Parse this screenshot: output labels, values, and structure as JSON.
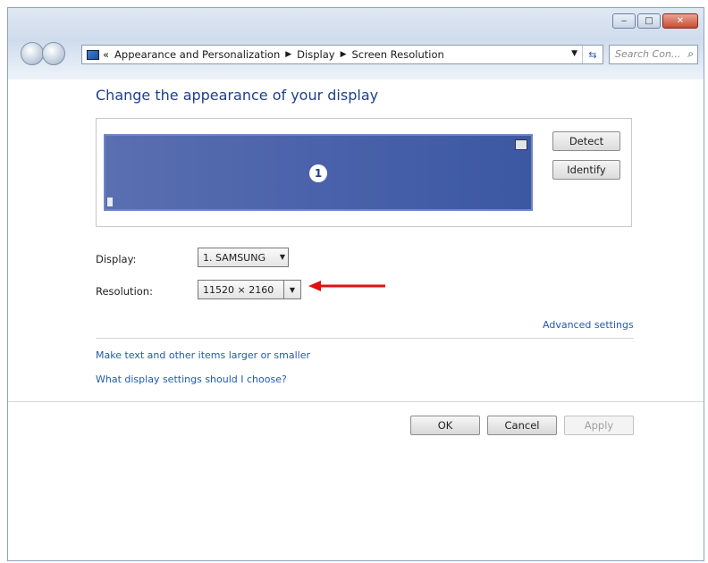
{
  "window": {
    "caption_buttons": [
      "minimize-icon",
      "maximize-icon",
      "close-icon"
    ]
  },
  "navbar": {
    "breadcrumb_prefix": "«",
    "breadcrumbs": [
      "Appearance and Personalization",
      "Display",
      "Screen Resolution"
    ],
    "search_placeholder": "Search Con..."
  },
  "main": {
    "title": "Change the appearance of your display",
    "monitor_number": "1",
    "detect_label": "Detect",
    "identify_label": "Identify",
    "display_label": "Display:",
    "display_value": "1. SAMSUNG",
    "resolution_label": "Resolution:",
    "resolution_value": "11520 × 2160",
    "advanced_settings_link": "Advanced settings",
    "link_text_size": "Make text and other items larger or smaller",
    "link_help": "What display settings should I choose?"
  },
  "footer": {
    "ok_label": "OK",
    "cancel_label": "Cancel",
    "apply_label": "Apply"
  },
  "colors": {
    "title": "#1e3f8a",
    "link": "#1f5ab3",
    "monitor": "#4a62aa",
    "annotation_arrow": "#e01010"
  }
}
